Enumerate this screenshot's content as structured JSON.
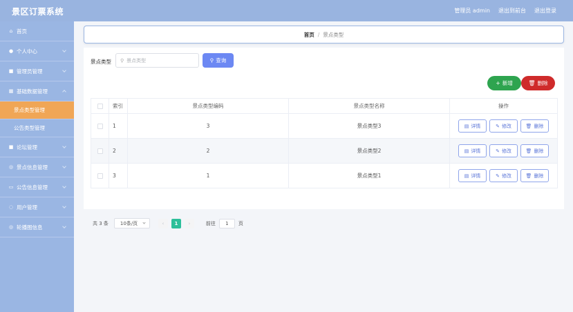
{
  "app": {
    "title": "景区订票系统",
    "role_user": "管理员 admin",
    "back_front": "退出到前台",
    "logout": "退出登录"
  },
  "sidebar": {
    "items": [
      {
        "label": "首页",
        "icon": "home-icon",
        "glyph": "⌂",
        "chevron": false
      },
      {
        "label": "个人中心",
        "icon": "user-icon",
        "glyph": "●",
        "chevron": true
      },
      {
        "label": "管理员管理",
        "icon": "admin-icon",
        "glyph": "■",
        "chevron": true
      },
      {
        "label": "基础数据管理",
        "icon": "grid-icon",
        "glyph": "▦",
        "chevron": true
      }
    ],
    "sub_items": [
      {
        "label": "景点类型管理",
        "active": true
      },
      {
        "label": "公告类型管理",
        "active": false
      }
    ],
    "items_after": [
      {
        "label": "论坛管理",
        "icon": "forum-icon",
        "glyph": "■",
        "chevron": true
      },
      {
        "label": "景点信息管理",
        "icon": "scenic-icon",
        "glyph": "◎",
        "chevron": true
      },
      {
        "label": "公告信息管理",
        "icon": "notice-icon",
        "glyph": "▭",
        "chevron": true
      },
      {
        "label": "用户管理",
        "icon": "users-icon",
        "glyph": "◌",
        "chevron": true
      },
      {
        "label": "轮播图信息",
        "icon": "carousel-icon",
        "glyph": "◎",
        "chevron": true
      }
    ]
  },
  "breadcrumb": {
    "home": "首页",
    "separator": "/",
    "current": "景点类型"
  },
  "search": {
    "label": "景点类型",
    "placeholder": "景点类型",
    "query_button": "查询"
  },
  "actions": {
    "add_label": "新增",
    "delete_label": "删除"
  },
  "table": {
    "headers": {
      "index": "索引",
      "code": "景点类型编码",
      "name": "景点类型名称",
      "ops": "操作"
    },
    "rows": [
      {
        "index": "1",
        "code": "3",
        "name": "景点类型3"
      },
      {
        "index": "2",
        "code": "2",
        "name": "景点类型2"
      },
      {
        "index": "3",
        "code": "1",
        "name": "景点类型1"
      }
    ],
    "row_buttons": {
      "detail": "详情",
      "edit": "修改",
      "delete": "删除"
    }
  },
  "pagination": {
    "total": "共 3 条",
    "page_size": "10条/页",
    "current_page": "1",
    "goto_label": "前往",
    "goto_value": "1",
    "page_unit": "页"
  },
  "colors": {
    "topbar": "#99b4e0",
    "sidebar": "#9ab6e3",
    "active_menu": "#f0a656",
    "query_button": "#6c88f3",
    "add_button": "#2ea44f",
    "delete_button": "#cf2b2b",
    "current_page": "#2dbf9a"
  }
}
